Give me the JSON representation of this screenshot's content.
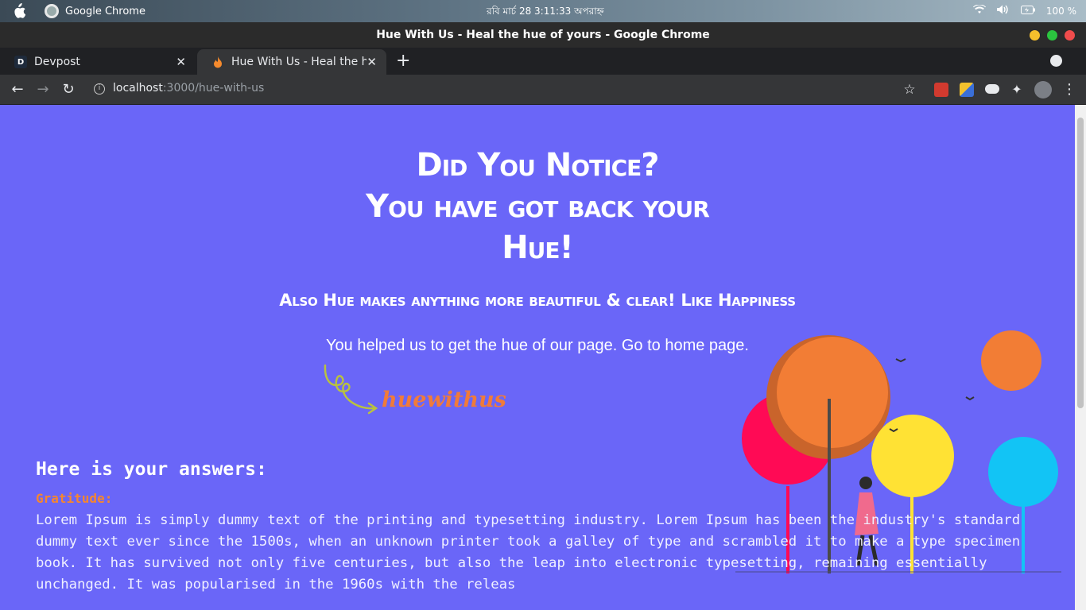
{
  "os": {
    "app_name": "Google Chrome",
    "clock": "রবি মার্চ 28   3:11:33 অপরাহ্ন",
    "battery": "100 %"
  },
  "window": {
    "title": "Hue With Us - Heal the hue of yours - Google Chrome"
  },
  "tabs": [
    {
      "label": "Devpost",
      "favicon": "D"
    },
    {
      "label": "Hue With Us - Heal the hue of yours",
      "favicon": "flame-icon"
    }
  ],
  "toolbar": {
    "url_host": "localhost",
    "url_rest": ":3000/hue-with-us"
  },
  "hero": {
    "line1": "Did You Notice?",
    "line2": "You have got back your",
    "line3": "Hue!",
    "subtitle": "Also Hue makes anything more beautiful & clear! Like Happiness",
    "link_prefix": "You helped us to get the hue of our page. ",
    "link_text": "Go to home page."
  },
  "logo": {
    "text": "huewithus"
  },
  "answers": {
    "title": "Here is your answers:",
    "items": [
      {
        "label": "Gratitude:",
        "text": "Lorem Ipsum is simply dummy text of the printing and typesetting industry. Lorem Ipsum has been the industry's standard dummy text ever since the 1500s, when an unknown printer took a galley of type and scrambled it to make a type specimen book. It has survived not only five centuries, but also the leap into electronic typesetting, remaining essentially unchanged. It was popularised in the 1960s with the releas"
      }
    ]
  },
  "colors": {
    "page_bg": "#6a66f8",
    "accent_orange": "#f07b3a",
    "tree_pink": "#ff0a55",
    "tree_yellow": "#ffe234",
    "tree_blue": "#12c4f5"
  }
}
